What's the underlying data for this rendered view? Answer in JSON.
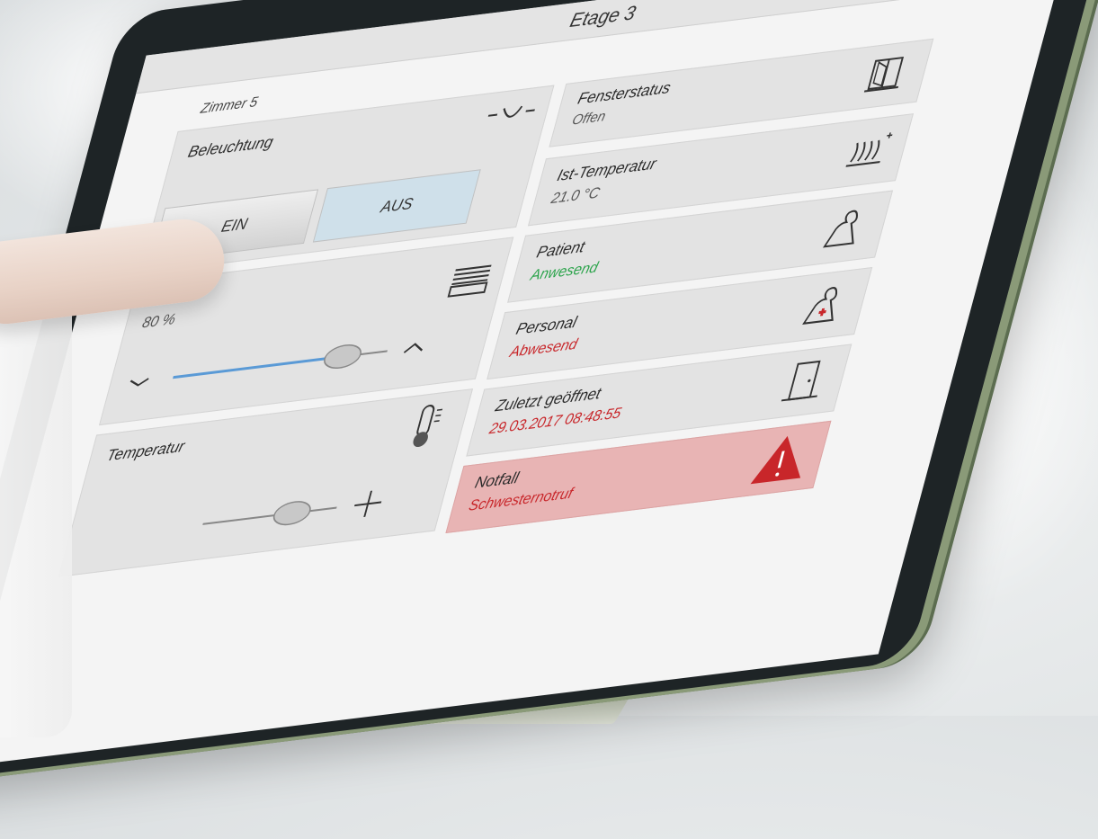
{
  "header": {
    "title": "Etage 3"
  },
  "room": {
    "label": "Zimmer 5"
  },
  "lighting": {
    "title": "Beleuchtung",
    "on_label": "EIN",
    "off_label": "AUS",
    "selected": "AUS"
  },
  "window_status": {
    "title": "Fensterstatus",
    "value": "Offen"
  },
  "temperature": {
    "title": "Ist-Temperatur",
    "value": "21.0 °C"
  },
  "blinds": {
    "value": "80 %",
    "level_percent": 80
  },
  "patient": {
    "title": "Patient",
    "value": "Anwesend"
  },
  "staff": {
    "title": "Personal",
    "value": "Abwesend"
  },
  "setpoint": {
    "title": "Temperatur"
  },
  "last_opened": {
    "title": "Zuletzt geöffnet",
    "value": "29.03.2017 08:48:55"
  },
  "emergency": {
    "title": "Notfall",
    "value": "Schwesternotruf"
  },
  "colors": {
    "ok": "#2aa34a",
    "alert": "#c8262a",
    "alarm_bg": "#e8b4b4",
    "off_btn": "#cfe0ea"
  },
  "icons": [
    "bulb-icon",
    "window-icon",
    "heating-icon",
    "blinds-icon",
    "patient-icon",
    "nurse-icon",
    "thermometer-icon",
    "door-icon",
    "warning-icon"
  ]
}
